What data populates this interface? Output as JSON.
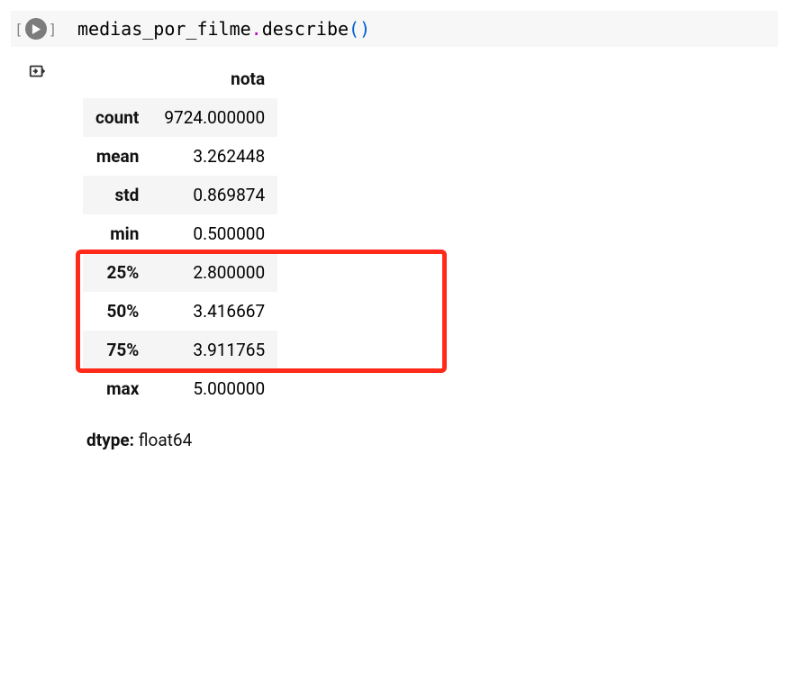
{
  "cell": {
    "number_open": "[",
    "number_close": "]",
    "code_ident": "medias_por_filme",
    "code_dot": ".",
    "code_method": "describe",
    "code_paren_open": "(",
    "code_paren_close": ")"
  },
  "table": {
    "header": {
      "blank": "",
      "col1": "nota"
    },
    "rows": [
      {
        "label": "count",
        "value": "9724.000000",
        "shaded": true
      },
      {
        "label": "mean",
        "value": "3.262448",
        "shaded": false
      },
      {
        "label": "std",
        "value": "0.869874",
        "shaded": true
      },
      {
        "label": "min",
        "value": "0.500000",
        "shaded": false
      },
      {
        "label": "25%",
        "value": "2.800000",
        "shaded": true
      },
      {
        "label": "50%",
        "value": "3.416667",
        "shaded": false
      },
      {
        "label": "75%",
        "value": "3.911765",
        "shaded": true
      },
      {
        "label": "max",
        "value": "5.000000",
        "shaded": false
      }
    ]
  },
  "dtype": {
    "label": "dtype:",
    "value": "float64"
  },
  "highlight": {
    "rows_start": 4,
    "rows_end": 6
  }
}
